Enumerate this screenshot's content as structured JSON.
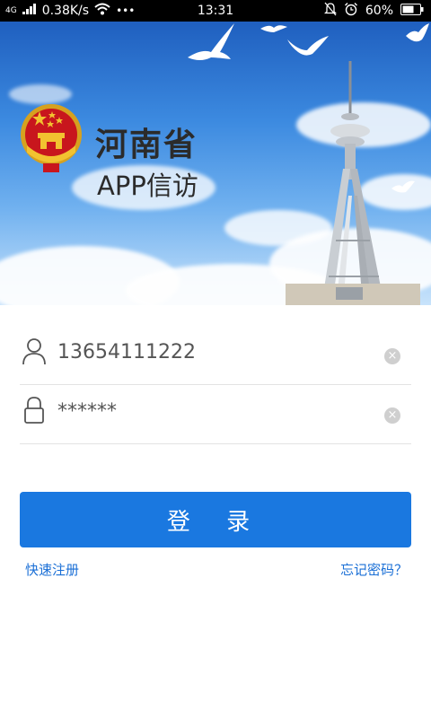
{
  "status_bar": {
    "network": "4G",
    "speed": "0.38K/s",
    "more": "•••",
    "time": "13:31",
    "battery": "60%"
  },
  "header": {
    "title": "河南省",
    "subtitle": "APP信访"
  },
  "login_form": {
    "username_value": "13654111222",
    "password_value": "******",
    "clear_glyph": "×",
    "login_label": "登 录",
    "register_link": "快速注册",
    "forgot_link": "忘记密码？"
  },
  "colors": {
    "primary": "#1a78e0",
    "link": "#1a6fd6"
  }
}
